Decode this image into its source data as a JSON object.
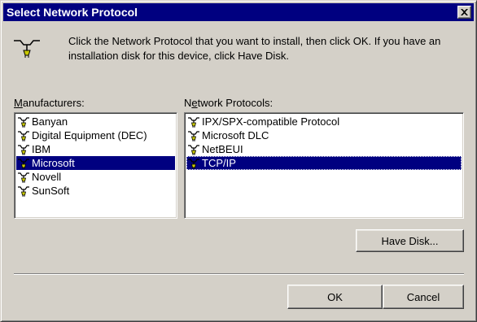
{
  "window": {
    "title": "Select Network Protocol",
    "close_icon": "close-icon"
  },
  "instructions": "Click the Network Protocol that you want to install, then click OK. If you have an installation disk for this device, click Have Disk.",
  "manufacturers": {
    "label": "Manufacturers:",
    "items": [
      "Banyan",
      "Digital Equipment (DEC)",
      "IBM",
      "Microsoft",
      "Novell",
      "SunSoft"
    ],
    "selected": "Microsoft"
  },
  "protocols": {
    "label": "Network Protocols:",
    "items": [
      "IPX/SPX-compatible Protocol",
      "Microsoft DLC",
      "NetBEUI",
      "TCP/IP"
    ],
    "selected": "TCP/IP"
  },
  "buttons": {
    "have_disk": "Have Disk...",
    "ok": "OK",
    "cancel": "Cancel"
  },
  "colors": {
    "titlebar": "#000080",
    "selection": "#000080",
    "face": "#d4d0c8",
    "protocol_icon": "#c8c800"
  }
}
